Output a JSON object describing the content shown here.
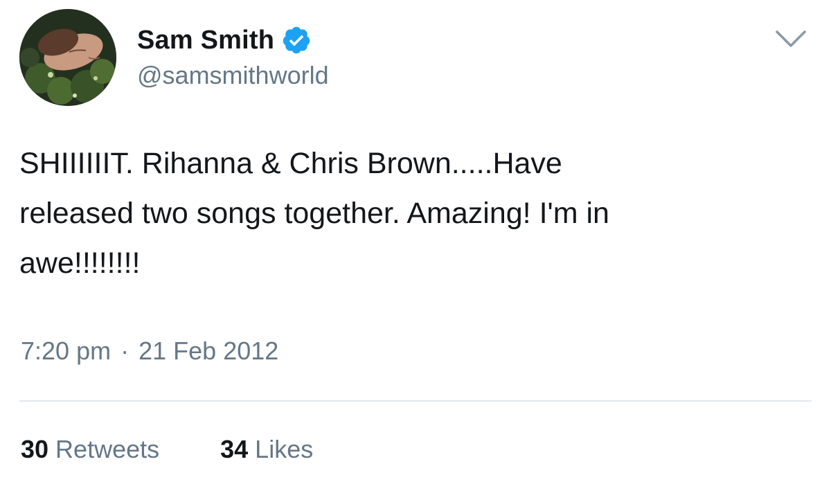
{
  "user": {
    "display_name": "Sam Smith",
    "handle": "@samsmithworld",
    "verified": true,
    "verified_icon": "verified-badge-icon",
    "verified_color": "#1da1f2"
  },
  "tweet": {
    "text": "SHIIIIIIT. Rihanna & Chris Brown.....Have\nreleased two songs together. Amazing! I'm in\nawe!!!!!!!!",
    "time": "7:20 pm",
    "separator": "·",
    "date": "21 Feb 2012"
  },
  "stats": {
    "retweets_count": "30",
    "retweets_label": "Retweets",
    "likes_count": "34",
    "likes_label": "Likes"
  },
  "menu": {
    "icon": "chevron-down-icon"
  },
  "colors": {
    "text": "#14171a",
    "secondary": "#657786",
    "divider": "#e1e8ed",
    "verified": "#1da1f2"
  }
}
